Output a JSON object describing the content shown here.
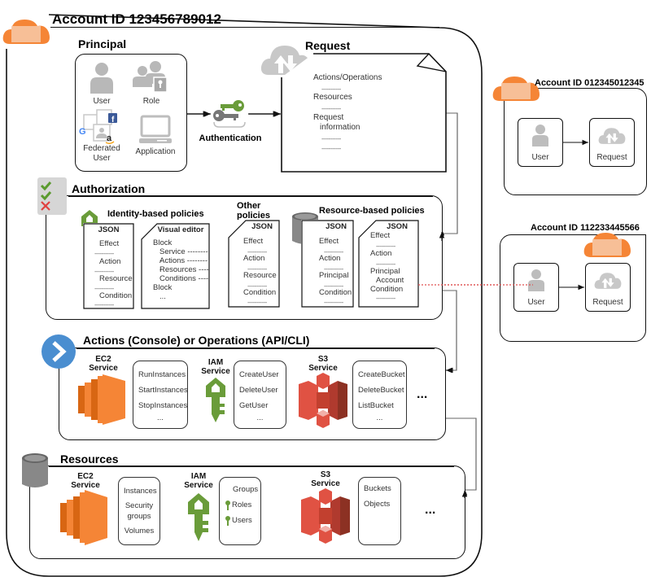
{
  "main_account": {
    "title": "Account ID 123456789012"
  },
  "principal": {
    "title": "Principal",
    "items": [
      {
        "label": "User",
        "icon": "user-icon"
      },
      {
        "label": "Role",
        "icon": "role-icon"
      },
      {
        "label": "Federated User",
        "line1": "Federated",
        "line2": "User",
        "icon": "federated-user-icon"
      },
      {
        "label": "Application",
        "icon": "application-icon"
      }
    ]
  },
  "authentication": {
    "label": "Authentication",
    "icon": "keys-icon"
  },
  "request": {
    "title": "Request",
    "lines": [
      "Actions/Operations",
      "-----------",
      "Resources",
      "-----------",
      "Request",
      "information",
      "-----------",
      "-----------"
    ]
  },
  "authorization": {
    "title": "Authorization",
    "identity_policies": {
      "title": "Identity-based policies",
      "json_doc": {
        "header": "JSON",
        "lines": [
          "Effect",
          "-----------",
          "Action",
          "-----------",
          "Resource",
          "-----------",
          "Condition",
          "-----------"
        ]
      },
      "visual_doc": {
        "header": "Visual editor",
        "lines": [
          "Block",
          "Service ---------",
          "Actions ---------",
          "Resources ----",
          "Conditions ----",
          "Block",
          "..."
        ]
      }
    },
    "other_policies": {
      "title_line1": "Other",
      "title_line2": "policies",
      "doc": {
        "header": "JSON",
        "lines": [
          "Effect",
          "-----------",
          "Action",
          "-----------",
          "Resource",
          "-----------",
          "Condition",
          "-----------"
        ]
      }
    },
    "resource_policies": {
      "title": "Resource-based policies",
      "doc1": {
        "header": "JSON",
        "lines": [
          "Effect",
          "-----------",
          "Action",
          "-----------",
          "Principal",
          "-----------",
          "Condition",
          "-----------"
        ]
      },
      "doc2": {
        "header": "JSON",
        "lines": [
          "Effect",
          "-----------",
          "Action",
          "-----------",
          "Principal",
          "Account",
          "Condition",
          "-----------"
        ]
      }
    }
  },
  "actions": {
    "title": "Actions (Console) or Operations (API/CLI)",
    "services": [
      {
        "name_line1": "EC2",
        "name_line2": "Service",
        "items": [
          "RunInstances",
          "StartInstances",
          "StopInstances",
          "..."
        ]
      },
      {
        "name_line1": "IAM",
        "name_line2": "Service",
        "items": [
          "CreateUser",
          "DeleteUser",
          "GetUser",
          "..."
        ]
      },
      {
        "name_line1": "S3",
        "name_line2": "Service",
        "items": [
          "CreateBucket",
          "DeleteBucket",
          "ListBucket",
          "..."
        ]
      }
    ],
    "more": "..."
  },
  "resources": {
    "title": "Resources",
    "services": [
      {
        "name_line1": "EC2",
        "name_line2": "Service",
        "items": [
          "Instances",
          "Security",
          "groups",
          "Volumes"
        ]
      },
      {
        "name_line1": "IAM",
        "name_line2": "Service",
        "items": [
          "Groups",
          "Roles",
          "Users"
        ]
      },
      {
        "name_line1": "S3",
        "name_line2": "Service",
        "items": [
          "Buckets",
          "Objects"
        ]
      }
    ],
    "more": "..."
  },
  "other_accounts": [
    {
      "title": "Account ID 012345012345",
      "user_label": "User",
      "request_label": "Request"
    },
    {
      "title": "Account ID 112233445566",
      "user_label": "User",
      "request_label": "Request"
    }
  ],
  "colors": {
    "aws_orange": "#F58536",
    "iam_green": "#6A9C3A",
    "s3_red": "#E05243",
    "gray_icon": "#B8B8B8",
    "actions_blue": "#4A8ED0",
    "cross_account_link": "#E05050"
  }
}
